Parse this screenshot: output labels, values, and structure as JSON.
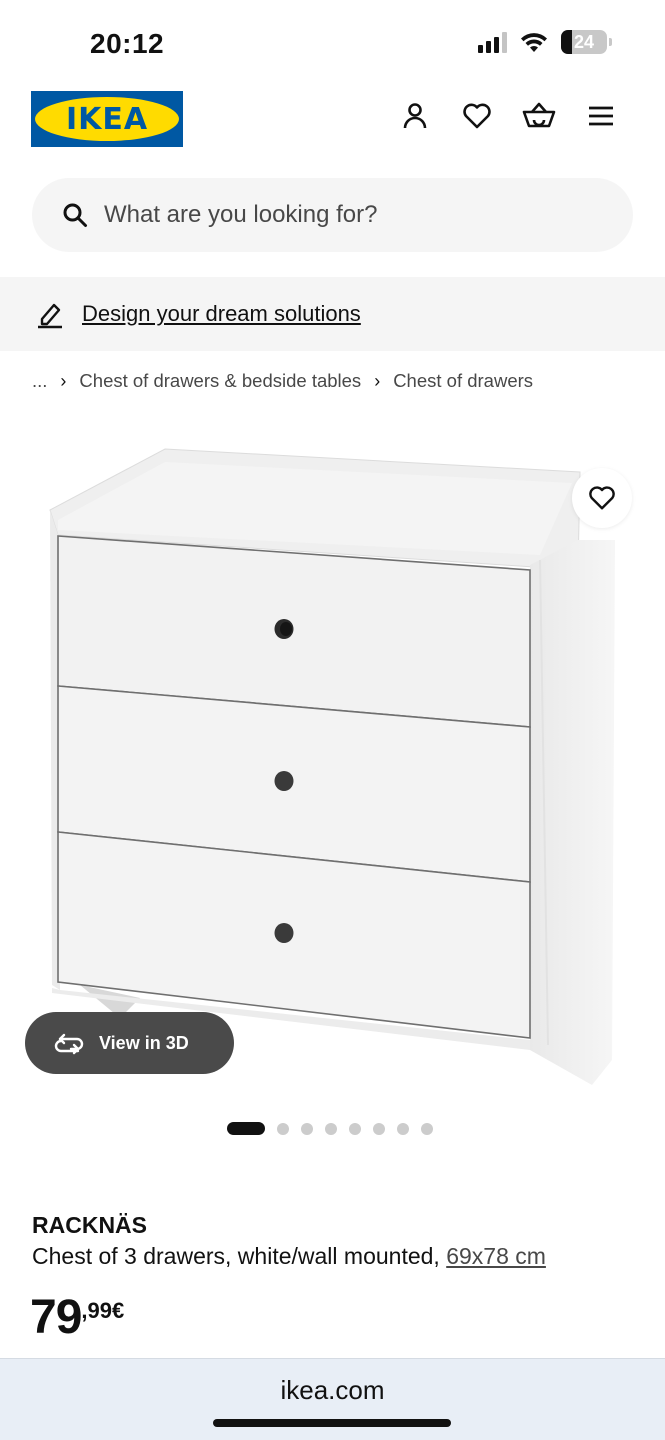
{
  "status_bar": {
    "time": "20:12",
    "battery_level": "24",
    "signal_icon": "cellular-signal-icon",
    "wifi_icon": "wifi-icon"
  },
  "header": {
    "logo_text": "IKEA",
    "logo_colors": {
      "background": "#0058a3",
      "oval": "#ffdb00"
    },
    "icons": [
      "account-icon",
      "heart-icon",
      "basket-icon",
      "menu-icon"
    ]
  },
  "search": {
    "placeholder": "What are you looking for?",
    "icon": "search-icon"
  },
  "promo": {
    "link_text": "Design your dream solutions",
    "icon": "pencil-icon"
  },
  "breadcrumb": {
    "items": [
      "...",
      "Chest of drawers & bedside tables",
      "Chest of drawers"
    ],
    "separator": "›"
  },
  "product_media": {
    "view_3d_label": "View in 3D",
    "view_3d_icon": "rotate-3d-icon",
    "favorite_icon": "heart-icon",
    "image_count": 8,
    "active_image": 1
  },
  "product": {
    "name": "RACKNÄS",
    "description": "Chest of 3 drawers, white/wall mounted, ",
    "size": "69x78 cm",
    "price_integer": "79",
    "price_decimal": ",99€"
  },
  "browser": {
    "url": "ikea.com"
  },
  "colors": {
    "text": "#111111",
    "secondary_text": "#484848",
    "surface": "#f5f5f5",
    "view_3d_button": "#4a4a4a",
    "browser_bar": "#e8eef6"
  }
}
